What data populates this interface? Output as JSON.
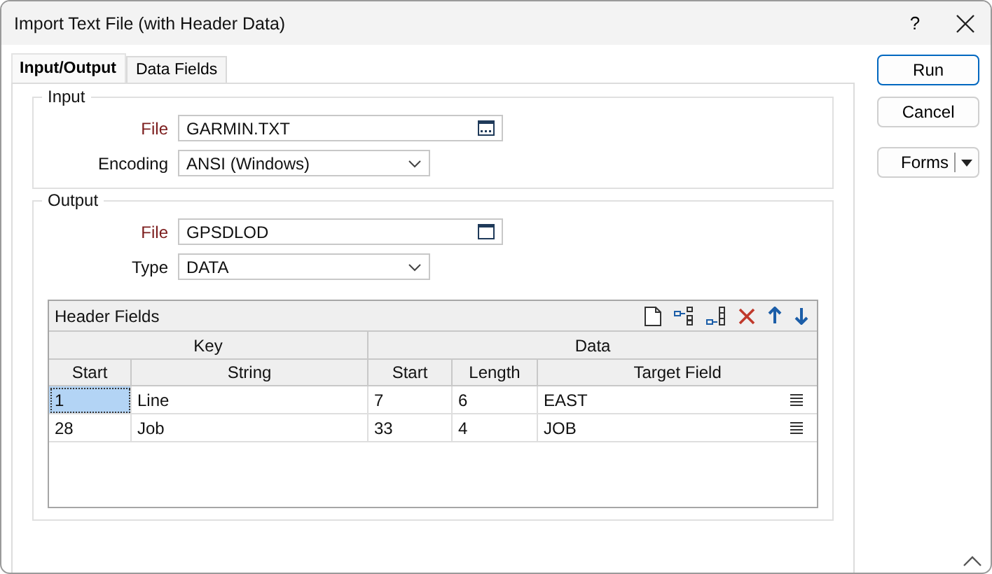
{
  "window": {
    "title": "Import Text File (with Header Data)",
    "help": "?"
  },
  "tabs": [
    {
      "label": "Input/Output",
      "selected": true
    },
    {
      "label": "Data Fields",
      "selected": false
    }
  ],
  "groups": [
    {
      "title": "Input",
      "fields": [
        {
          "label": "File",
          "value": "GARMIN.TXT",
          "kind": "browse",
          "required": true
        },
        {
          "label": "Encoding",
          "value": "ANSI (Windows)",
          "kind": "dropdown",
          "required": false
        }
      ]
    },
    {
      "title": "Output",
      "fields": [
        {
          "label": "File",
          "value": "GPSDLOD",
          "kind": "calendar",
          "required": true
        },
        {
          "label": "Type",
          "value": "DATA",
          "kind": "dropdown",
          "required": false
        }
      ]
    }
  ],
  "grid": {
    "title": "Header Fields",
    "column_groups": [
      {
        "label": "Key"
      },
      {
        "label": "Data"
      }
    ],
    "columns": [
      "Start",
      "String",
      "Start",
      "Length",
      "Target Field"
    ],
    "rows": [
      {
        "cells": [
          {
            "text": "1",
            "selected": true
          },
          {
            "text": "Line",
            "selected": false
          },
          {
            "text": "7",
            "selected": false
          },
          {
            "text": "6",
            "selected": false
          },
          {
            "text": "EAST",
            "selected": false
          }
        ]
      },
      {
        "cells": [
          {
            "text": "28",
            "selected": false
          },
          {
            "text": "Job",
            "selected": false
          },
          {
            "text": "33",
            "selected": false
          },
          {
            "text": "4",
            "selected": false
          },
          {
            "text": "JOB",
            "selected": false
          }
        ]
      }
    ]
  },
  "buttons": [
    {
      "label": "Run",
      "kind": "default"
    },
    {
      "label": "Cancel",
      "kind": "plain"
    },
    {
      "label": "Forms",
      "kind": "split"
    }
  ]
}
